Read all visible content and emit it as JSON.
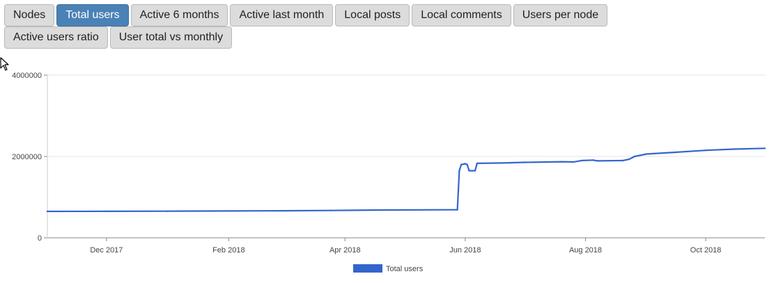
{
  "tabs": [
    {
      "label": "Nodes",
      "active": false
    },
    {
      "label": "Total users",
      "active": true
    },
    {
      "label": "Active 6 months",
      "active": false
    },
    {
      "label": "Active last month",
      "active": false
    },
    {
      "label": "Local posts",
      "active": false
    },
    {
      "label": "Local comments",
      "active": false
    },
    {
      "label": "Users per node",
      "active": false
    },
    {
      "label": "Active users ratio",
      "active": false
    },
    {
      "label": "User total vs monthly",
      "active": false
    }
  ],
  "chart_data": {
    "type": "line",
    "title": "",
    "xlabel": "",
    "ylabel": "",
    "ylim": [
      0,
      4000000
    ],
    "xlim": [
      "2017-11-01",
      "2018-10-31"
    ],
    "y_ticks": [
      "0",
      "2000000",
      "4000000"
    ],
    "y_tick_values": [
      0,
      2000000,
      4000000
    ],
    "x_ticks": [
      "Dec 2017",
      "Feb 2018",
      "Apr 2018",
      "Jun 2018",
      "Aug 2018",
      "Oct 2018"
    ],
    "x_tick_dates": [
      "2017-12-01",
      "2018-02-01",
      "2018-04-01",
      "2018-06-01",
      "2018-08-01",
      "2018-10-01"
    ],
    "grid": true,
    "legend": "bottom",
    "series": [
      {
        "name": "Total users",
        "color": "#3366cc",
        "points": [
          [
            "2017-11-01",
            650000
          ],
          [
            "2017-12-01",
            652000
          ],
          [
            "2018-01-01",
            655000
          ],
          [
            "2018-02-01",
            660000
          ],
          [
            "2018-03-01",
            665000
          ],
          [
            "2018-03-25",
            672000
          ],
          [
            "2018-04-15",
            682000
          ],
          [
            "2018-05-28",
            690000
          ],
          [
            "2018-05-29",
            1650000
          ],
          [
            "2018-05-30",
            1800000
          ],
          [
            "2018-06-01",
            1820000
          ],
          [
            "2018-06-02",
            1800000
          ],
          [
            "2018-06-03",
            1650000
          ],
          [
            "2018-06-06",
            1650000
          ],
          [
            "2018-06-07",
            1830000
          ],
          [
            "2018-06-20",
            1840000
          ],
          [
            "2018-07-01",
            1855000
          ],
          [
            "2018-07-20",
            1870000
          ],
          [
            "2018-07-26",
            1865000
          ],
          [
            "2018-07-30",
            1900000
          ],
          [
            "2018-08-05",
            1910000
          ],
          [
            "2018-08-07",
            1890000
          ],
          [
            "2018-08-20",
            1900000
          ],
          [
            "2018-08-23",
            1930000
          ],
          [
            "2018-08-26",
            2000000
          ],
          [
            "2018-09-01",
            2060000
          ],
          [
            "2018-09-15",
            2100000
          ],
          [
            "2018-10-01",
            2150000
          ],
          [
            "2018-10-15",
            2180000
          ],
          [
            "2018-10-31",
            2200000
          ]
        ]
      }
    ]
  }
}
